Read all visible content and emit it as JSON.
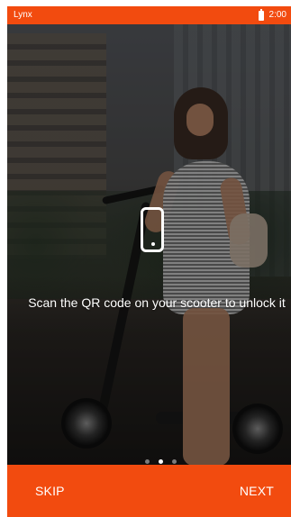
{
  "status_bar": {
    "app_title": "Lynx",
    "time": "2:00",
    "battery_icon": "battery-icon"
  },
  "onboarding": {
    "message": "Scan the QR code on your scooter to unlock it",
    "icon": "smartphone-icon",
    "pager": {
      "total": 3,
      "active_index": 1
    }
  },
  "bottom_bar": {
    "skip_label": "SKIP",
    "next_label": "NEXT"
  },
  "colors": {
    "accent": "#f24b0f",
    "overlay": "#000000"
  }
}
